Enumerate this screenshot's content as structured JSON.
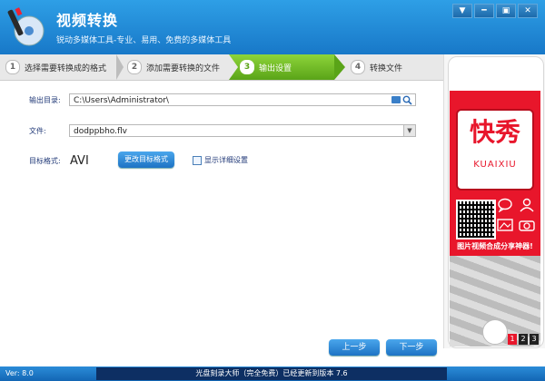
{
  "header": {
    "title": "视频转换",
    "subtitle": "锐动多媒体工具-专业、易用、免费的多媒体工具",
    "controls": [
      "▼",
      "━",
      "▣",
      "✕"
    ]
  },
  "steps": [
    {
      "num": "1",
      "label": "选择需要转换成的格式",
      "active": false
    },
    {
      "num": "2",
      "label": "添加需要转换的文件",
      "active": false
    },
    {
      "num": "3",
      "label": "输出设置",
      "active": true
    },
    {
      "num": "4",
      "label": "转换文件",
      "active": false
    }
  ],
  "form": {
    "output_label": "输出目录:",
    "output_path": "C:\\Users\\Administrator\\",
    "file_label": "文件:",
    "file_value": "dodppbho.flv",
    "format_label": "目标格式:",
    "format_value": "AVI",
    "change_format_button": "更改目标格式",
    "show_details_label": "显示详细设置"
  },
  "nav": {
    "prev": "上一步",
    "next": "下一步"
  },
  "ad": {
    "brand_cn": "快秀",
    "brand_en": "KUAIXIU",
    "slogan": "图片视频合成分享神器!",
    "pages": [
      "1",
      "2",
      "3"
    ]
  },
  "status": {
    "version": "Ver: 8.0",
    "message": "光盘刻录大师（完全免费）已经更新到版本 7.6"
  },
  "colors": {
    "header_blue": "#1e86d6",
    "active_step_green": "#6cb825",
    "label_blue": "#223a78",
    "ad_red": "#e8162b"
  }
}
